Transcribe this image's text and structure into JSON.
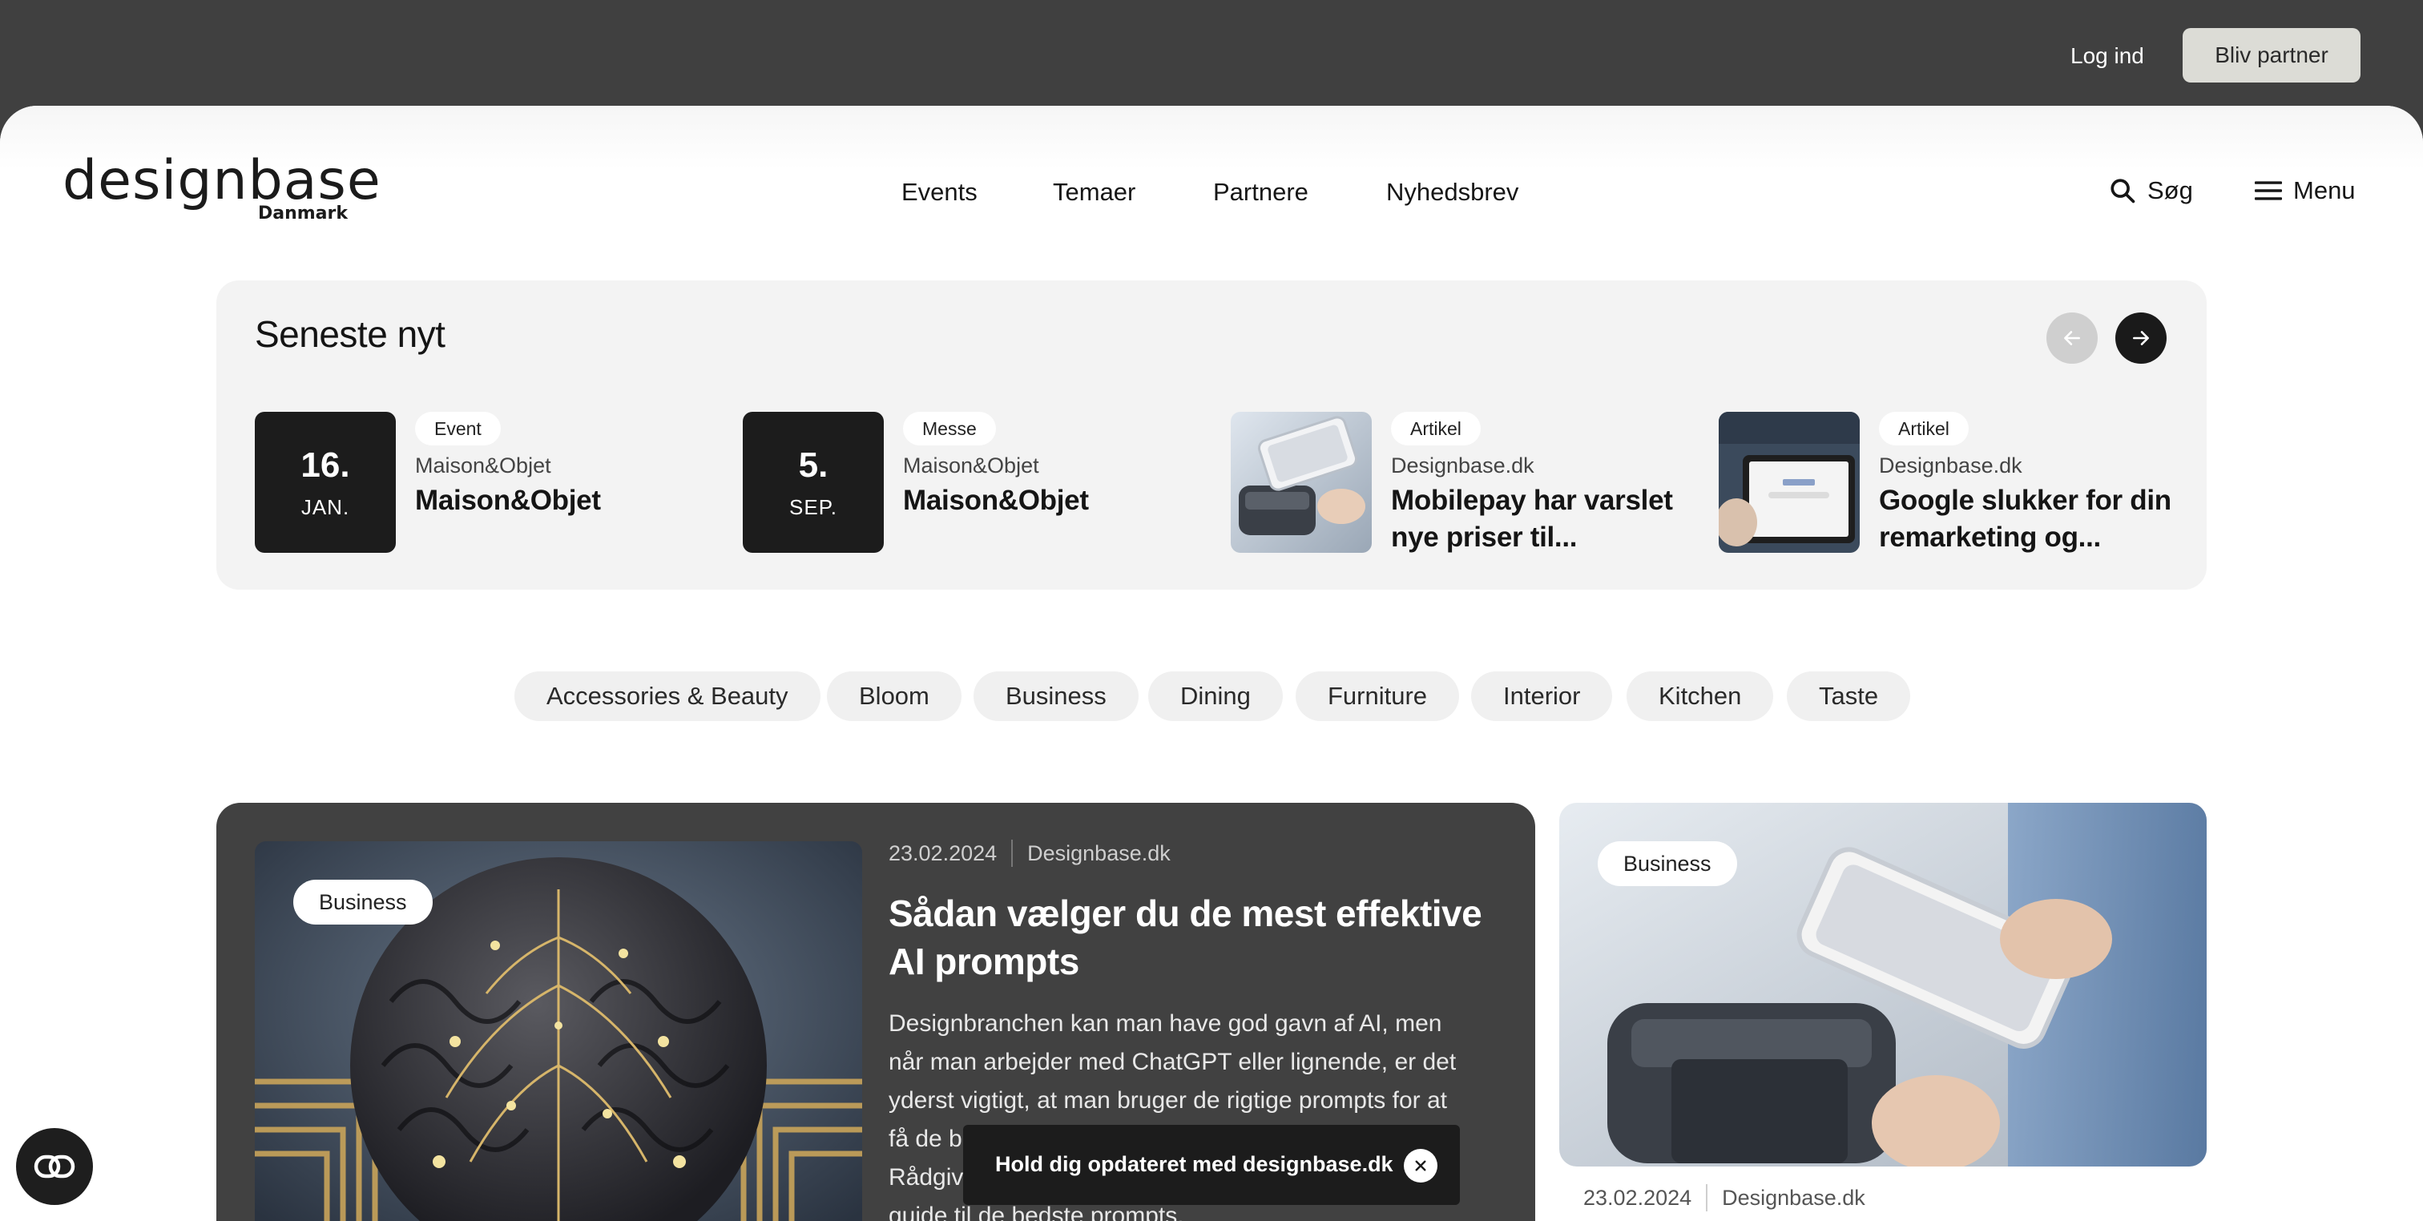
{
  "topbar": {
    "login_label": "Log ind",
    "partner_label": "Bliv partner"
  },
  "header": {
    "logo_main": "designbase",
    "logo_sub": "Danmark",
    "nav": [
      {
        "label": "Events"
      },
      {
        "label": "Temaer"
      },
      {
        "label": "Partnere"
      },
      {
        "label": "Nyhedsbrev"
      }
    ],
    "search_label": "Søg",
    "menu_label": "Menu"
  },
  "latest": {
    "title": "Seneste nyt",
    "items": [
      {
        "day": "16.",
        "month": "JAN.",
        "tag": "Event",
        "source": "Maison&Objet",
        "title": "Maison&Objet"
      },
      {
        "day": "5.",
        "month": "SEP.",
        "tag": "Messe",
        "source": "Maison&Objet",
        "title": "Maison&Objet"
      },
      {
        "tag": "Artikel",
        "source": "Designbase.dk",
        "title": "Mobilepay har varslet nye priser til..."
      },
      {
        "tag": "Artikel",
        "source": "Designbase.dk",
        "title": "Google slukker for din remarketing og..."
      }
    ]
  },
  "categories": [
    "Accessories & Beauty",
    "Bloom",
    "Business",
    "Dining",
    "Furniture",
    "Interior",
    "Kitchen",
    "Taste"
  ],
  "featured": {
    "badge": "Business",
    "date": "23.02.2024",
    "source": "Designbase.dk",
    "title": "Sådan vælger du de mest effektive AI prompts",
    "body_lines": [
      "Designbranchen kan man have god gavn af AI, men",
      "når man arbejder med ChatGPT eller lignende, er det",
      "yderst vigtigt, at man bruger de rigtige prompts for at",
      "få de b",
      "Rådgiv",
      "guide til de bedste prompts."
    ]
  },
  "side_article": {
    "badge": "Business",
    "date": "23.02.2024",
    "source": "Designbase.dk"
  },
  "toast": {
    "text": "Hold dig opdateret med designbase.dk"
  },
  "colors": {
    "topbar": "#404040",
    "card_dark": "#414141",
    "panel": "#f3f3f3",
    "chip": "#f0f0f0"
  }
}
